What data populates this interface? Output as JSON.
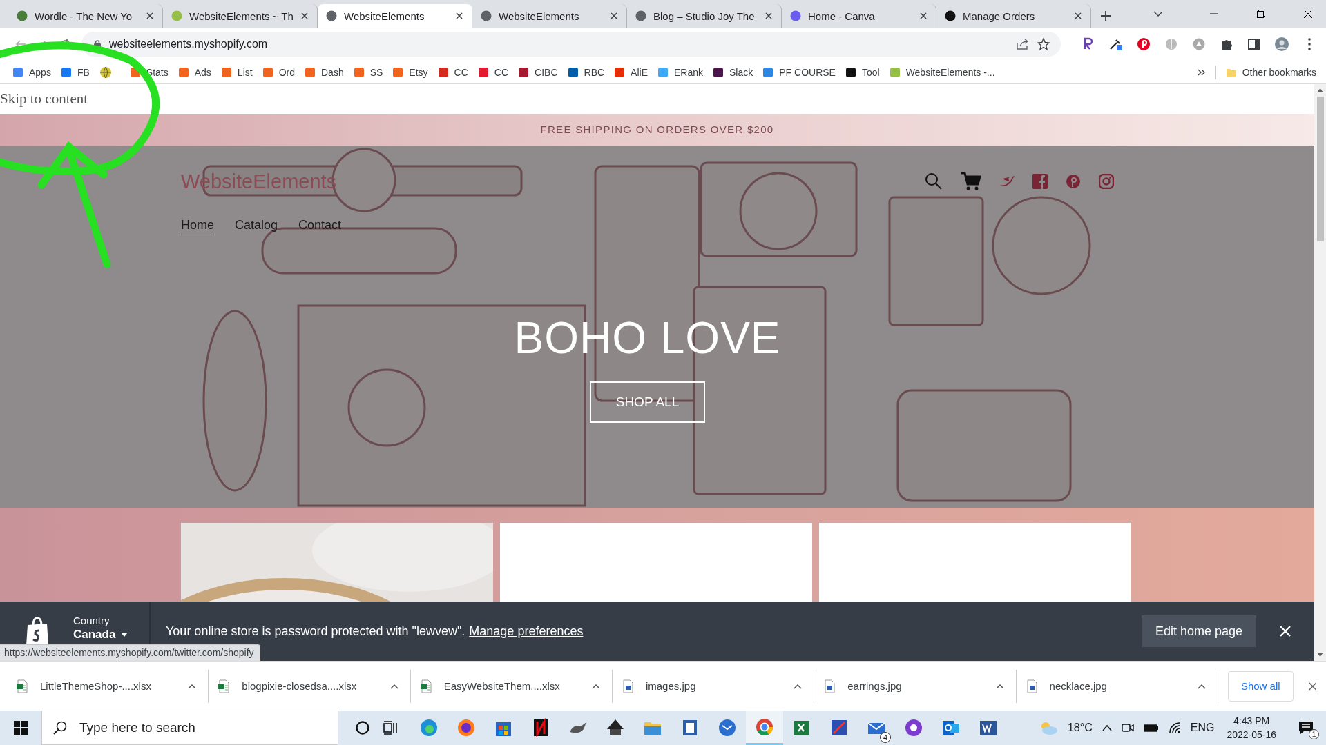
{
  "browser": {
    "tabs": [
      {
        "title": "Wordle - The New Yo",
        "color": "#4a7c3a",
        "selected": false
      },
      {
        "title": "WebsiteElements ~ Th",
        "color": "#95bf47",
        "selected": false
      },
      {
        "title": "WebsiteElements",
        "color": "#5f6368",
        "selected": true
      },
      {
        "title": "WebsiteElements",
        "color": "#5f6368",
        "selected": false
      },
      {
        "title": "Blog – Studio Joy The",
        "color": "#5f6368",
        "selected": false
      },
      {
        "title": "Home - Canva",
        "color": "#6a5cf0",
        "selected": false
      },
      {
        "title": "Manage Orders",
        "color": "#111111",
        "selected": false
      }
    ],
    "url": "websiteelements.myshopify.com",
    "bookmarks": [
      {
        "label": "Apps",
        "color": "#4285f4"
      },
      {
        "label": "FB",
        "color": "#1877f2"
      },
      {
        "label": "Stats",
        "color": "#f1641e"
      },
      {
        "label": "Ads",
        "color": "#f1641e"
      },
      {
        "label": "List",
        "color": "#f1641e"
      },
      {
        "label": "Ord",
        "color": "#f1641e"
      },
      {
        "label": "Dash",
        "color": "#f1641e"
      },
      {
        "label": "SS",
        "color": "#f1641e"
      },
      {
        "label": "Etsy",
        "color": "#f1641e"
      },
      {
        "label": "CC",
        "color": "#d52b1e"
      },
      {
        "label": "CC",
        "color": "#e3192d"
      },
      {
        "label": "CIBC",
        "color": "#a6192e"
      },
      {
        "label": "RBC",
        "color": "#005daa"
      },
      {
        "label": "AliE",
        "color": "#e62e04"
      },
      {
        "label": "ERank",
        "color": "#3fa9f5"
      },
      {
        "label": "Slack",
        "color": "#4a154b"
      },
      {
        "label": "PF COURSE",
        "color": "#2d88e3"
      },
      {
        "label": "Tool",
        "color": "#111111"
      },
      {
        "label": "WebsiteElements -...",
        "color": "#95bf47"
      }
    ],
    "other_bookmarks": "Other bookmarks"
  },
  "page": {
    "skip_link": "Skip to content",
    "announcement": "FREE SHIPPING ON ORDERS OVER $200",
    "logo": "WebsiteElements",
    "nav": [
      {
        "label": "Home",
        "selected": true
      },
      {
        "label": "Catalog",
        "selected": false
      },
      {
        "label": "Contact",
        "selected": false
      }
    ],
    "hero": {
      "heading": "BOHO LOVE",
      "button": "SHOP ALL"
    },
    "products": [
      {
        "kind": "picture"
      },
      {
        "kind": "blank"
      },
      {
        "kind": "blank"
      }
    ],
    "store_bar": {
      "country_label": "Country",
      "country": "Canada",
      "message": "Your online store is password protected with \"lewvew\".",
      "link": "Manage preferences",
      "button": "Edit home page"
    },
    "status_url": "https://websiteelements.myshopify.com/twitter.com/shopify"
  },
  "downloads": {
    "files": [
      {
        "name": "LittleThemeShop-....xlsx",
        "kind": "sheet"
      },
      {
        "name": "blogpixie-closedsa....xlsx",
        "kind": "sheet"
      },
      {
        "name": "EasyWebsiteThem....xlsx",
        "kind": "sheet"
      },
      {
        "name": "images.jpg"
      },
      {
        "name": "earrings.jpg"
      },
      {
        "name": "necklace.jpg"
      }
    ],
    "show_all": "Show all"
  },
  "taskbar": {
    "search_placeholder": "Type here to search",
    "mail_badge": "4",
    "temperature": "18°C",
    "language": "ENG",
    "time": "4:43 PM",
    "date": "2022-05-16",
    "notifications": "1"
  }
}
